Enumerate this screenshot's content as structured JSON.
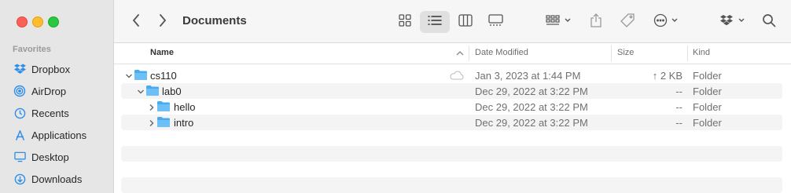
{
  "sidebar": {
    "section_title": "Favorites",
    "items": [
      {
        "label": "Dropbox",
        "icon": "dropbox-icon"
      },
      {
        "label": "AirDrop",
        "icon": "airdrop-icon"
      },
      {
        "label": "Recents",
        "icon": "clock-icon"
      },
      {
        "label": "Applications",
        "icon": "applications-icon"
      },
      {
        "label": "Desktop",
        "icon": "desktop-icon"
      },
      {
        "label": "Downloads",
        "icon": "download-icon"
      }
    ]
  },
  "toolbar": {
    "title": "Documents",
    "active_view": "list"
  },
  "columns": {
    "name": "Name",
    "date": "Date Modified",
    "size": "Size",
    "kind": "Kind"
  },
  "rows": [
    {
      "name": "cs110",
      "date": "Jan 3, 2023 at 1:44 PM",
      "size": "↑ 2 KB",
      "kind": "Folder",
      "level": 0,
      "expanded": true,
      "cloud": true
    },
    {
      "name": "lab0",
      "date": "Dec 29, 2022 at 3:22 PM",
      "size": "--",
      "kind": "Folder",
      "level": 1,
      "expanded": true
    },
    {
      "name": "hello",
      "date": "Dec 29, 2022 at 3:22 PM",
      "size": "--",
      "kind": "Folder",
      "level": 2,
      "expanded": false
    },
    {
      "name": "intro",
      "date": "Dec 29, 2022 at 3:22 PM",
      "size": "--",
      "kind": "Folder",
      "level": 2,
      "expanded": false
    }
  ],
  "colors": {
    "accent": "#2f8ee8",
    "folder": "#4aaaee",
    "sidebar_bg": "#e6e6e6"
  }
}
